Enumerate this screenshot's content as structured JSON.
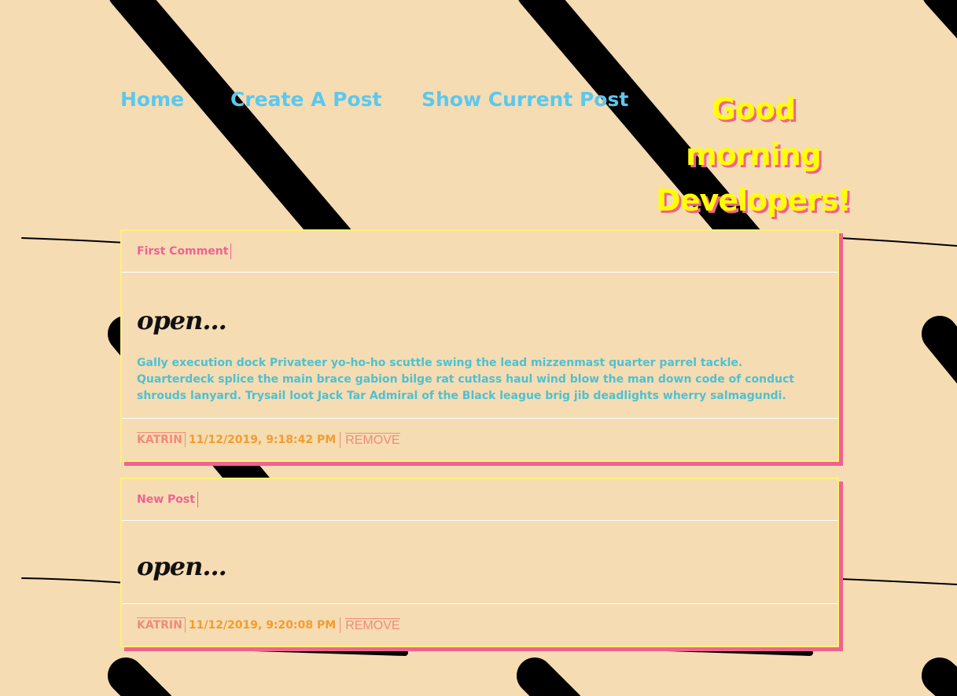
{
  "nav": {
    "home": "Home",
    "create_post": "Create A Post",
    "show_current_post": "Show Current Post"
  },
  "greeting": {
    "line1": "Good",
    "line2": "morning",
    "line3": "Developers!"
  },
  "colors": {
    "background": "#f5dcb3",
    "nav_link": "#5bc8ee",
    "greeting": "#ffff00",
    "greeting_shadow": "#f06292",
    "card_border": "#fff176",
    "card_shadow": "#f06292",
    "post_title": "#f06292",
    "post_content": "#4ec1d0",
    "author": "#f28a7a",
    "date": "#f39c2d"
  },
  "posts": [
    {
      "title": "First Comment",
      "open_label": "open...",
      "content": "Gally execution dock Privateer yo-ho-ho scuttle swing the lead mizzenmast quarter parrel tackle. Quarterdeck splice the main brace gabion bilge rat cutlass haul wind blow the man down code of conduct shrouds lanyard. Trysail loot Jack Tar Admiral of the Black league brig jib deadlights wherry salmagundi.",
      "author": "KATRIN",
      "date": "11/12/2019, 9:18:42 PM",
      "remove_label": "REMOVE"
    },
    {
      "title": "New Post",
      "open_label": "open...",
      "author": "KATRIN",
      "date": "11/12/2019, 9:20:08 PM",
      "remove_label": "REMOVE"
    }
  ]
}
